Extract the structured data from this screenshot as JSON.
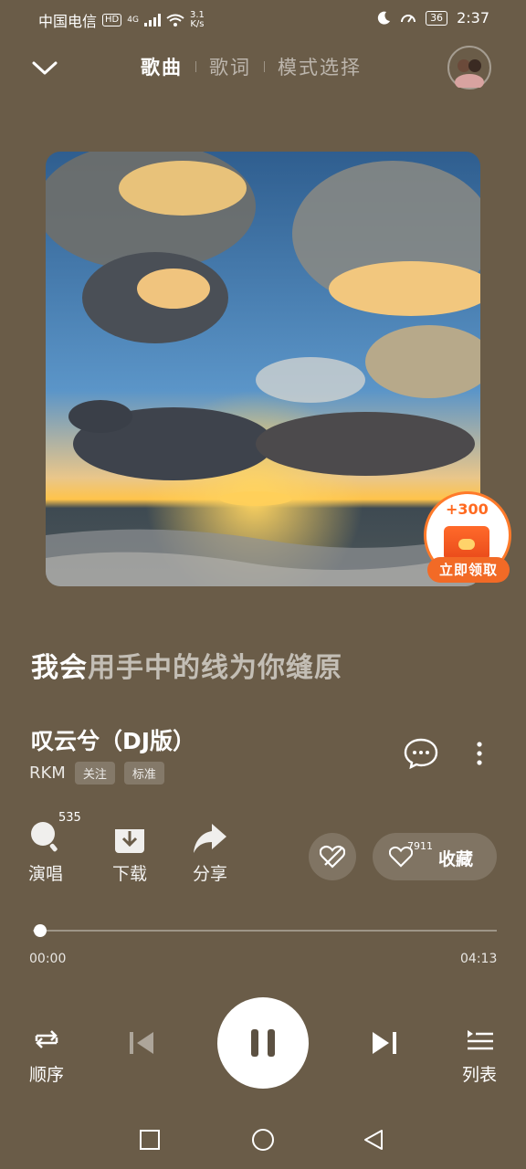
{
  "status": {
    "carrier": "中国电信",
    "hd": "HD",
    "network": "4G",
    "speed_value": "3.1",
    "speed_unit": "K/s",
    "battery": "36",
    "time": "2:37"
  },
  "header": {
    "tabs": [
      "歌曲",
      "歌词",
      "模式选择"
    ],
    "active_tab": 0
  },
  "reward": {
    "bonus": "+300",
    "claim": "立即领取"
  },
  "lyric": {
    "sung": "我会",
    "upcoming": "用手中的线为你缝原"
  },
  "song": {
    "title": "叹云兮（DJ版）",
    "artist": "RKM",
    "follow": "关注",
    "quality": "标准"
  },
  "actions": {
    "sing_count": "535",
    "sing": "演唱",
    "download": "下载",
    "share": "分享",
    "collect_count": "7911",
    "collect": "收藏"
  },
  "progress": {
    "current": "00:00",
    "duration": "04:13",
    "fraction": 0.01
  },
  "player": {
    "mode": "顺序",
    "list": "列表"
  },
  "colors": {
    "background": "#6a5c48",
    "accent": "#f26a26"
  }
}
